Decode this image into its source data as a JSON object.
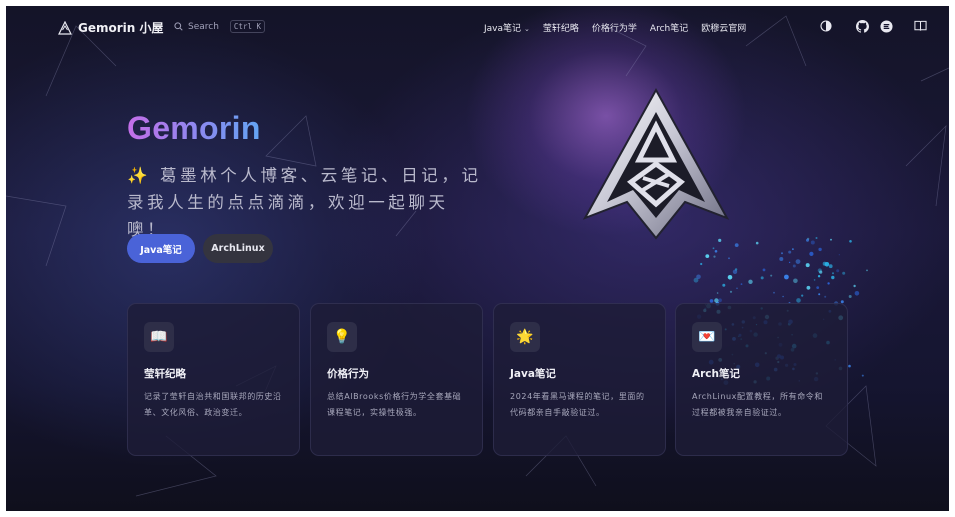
{
  "nav": {
    "brand": "Gemorin 小屋",
    "search_label": "Search",
    "search_shortcut": "Ctrl K",
    "links": [
      {
        "label": "Java笔记",
        "has_dropdown": true
      },
      {
        "label": "莹轩纪略",
        "has_dropdown": false
      },
      {
        "label": "价格行为学",
        "has_dropdown": false
      },
      {
        "label": "Arch笔记",
        "has_dropdown": false
      },
      {
        "label": "欧穆云官网",
        "has_dropdown": false
      }
    ],
    "icons": [
      "theme-toggle-icon",
      "github-icon",
      "gitee-icon",
      "book-icon"
    ]
  },
  "hero": {
    "name": "Gemorin",
    "tagline": "✨ 葛墨林个人博客、云笔记、日记，记录我人生的点点滴滴，欢迎一起聊天噢！",
    "actions": [
      {
        "label": "Java笔记",
        "style": "primary"
      },
      {
        "label": "ArchLinux",
        "style": "alt"
      }
    ],
    "emblem_icon": "gemorin-emblem-logo"
  },
  "features": [
    {
      "icon": "📖",
      "icon_name": "book-icon",
      "title": "莹轩纪略",
      "details": "记录了莹轩自治共和国联邦的历史沿革、文化风俗、政治变迁。"
    },
    {
      "icon": "💡",
      "icon_name": "lightbulb-icon",
      "title": "价格行为",
      "details": "总结AlBrooks价格行为学全套基础课程笔记，实操性极强。"
    },
    {
      "icon": "🌟",
      "icon_name": "star-icon",
      "title": "Java笔记",
      "details": "2024年看黑马课程的笔记，里面的代码都亲自手敲验证过。"
    },
    {
      "icon": "💌",
      "icon_name": "love-letter-icon",
      "title": "Arch笔记",
      "details": "ArchLinux配置教程，所有命令和过程都被我亲自验证过。"
    }
  ],
  "colors": {
    "background": "#15152e",
    "primary_button": "#4a63d8",
    "alt_button": "#34343f",
    "brand_gradient_start": "#c46ee8",
    "brand_gradient_end": "#63a4f2"
  }
}
